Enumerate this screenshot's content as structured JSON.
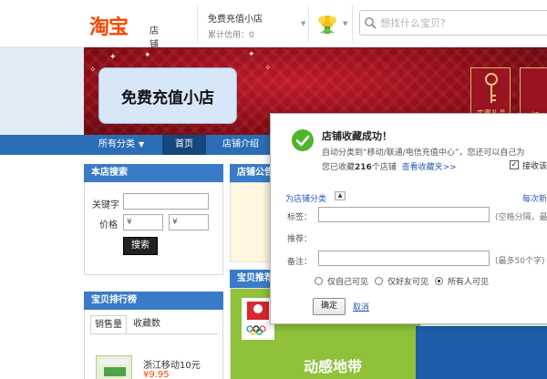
{
  "header": {
    "logo_main": "淘宝",
    "logo_sub": "店铺",
    "shop_name": "免费充值小店",
    "credit": "累计信用：0",
    "search_placeholder": "想找什么宝贝?"
  },
  "banner": {
    "shop_title": "免费充值小店",
    "gift_label": "实惠礼品",
    "gift2_label": "加"
  },
  "nav": {
    "items": [
      {
        "label": "所有分类"
      },
      {
        "label": "首页"
      },
      {
        "label": "店铺介绍"
      }
    ]
  },
  "sidebar": {
    "search_panel": {
      "title": "本店搜索",
      "keyword_label": "关键字",
      "price_label": "价格",
      "price_min_prefix": "¥",
      "price_max_prefix": "¥",
      "search_button": "搜索"
    },
    "ranking_panel": {
      "title": "宝贝排行榜",
      "tabs": [
        "销售量",
        "收藏数"
      ],
      "item_name": "浙江移动10元",
      "item_price": "¥9.95"
    }
  },
  "middle": {
    "announce_title": "店铺公告",
    "recommend_title": "宝贝推荐",
    "promo_text": "动感地带"
  },
  "dialog": {
    "title": "店铺收藏成功！",
    "line1": "自动分类到“移动/联通/电信充值中心”，您还可以自己为",
    "line2_prefix": "您已收藏",
    "line2_count": "216",
    "line2_suffix": "个店铺",
    "view_favorites": "查看收藏夹>>",
    "receive_label": "接收该",
    "category_label": "为店铺分类",
    "category_right": "每次新",
    "tags_label": "标签：",
    "tags_note": "(空格分隔，最",
    "recommend_label": "推荐：",
    "note_label": "备注：",
    "note_note": "(最多50个字)",
    "visibility": [
      "仅自己可见",
      "仅好友可见",
      "所有人可见"
    ],
    "ok_button": "确定",
    "cancel_link": "取消"
  },
  "colors": {
    "nav_blue": "#2c6eb6",
    "taobao_orange": "#ff4400",
    "banner_red": "#8d0c18"
  }
}
